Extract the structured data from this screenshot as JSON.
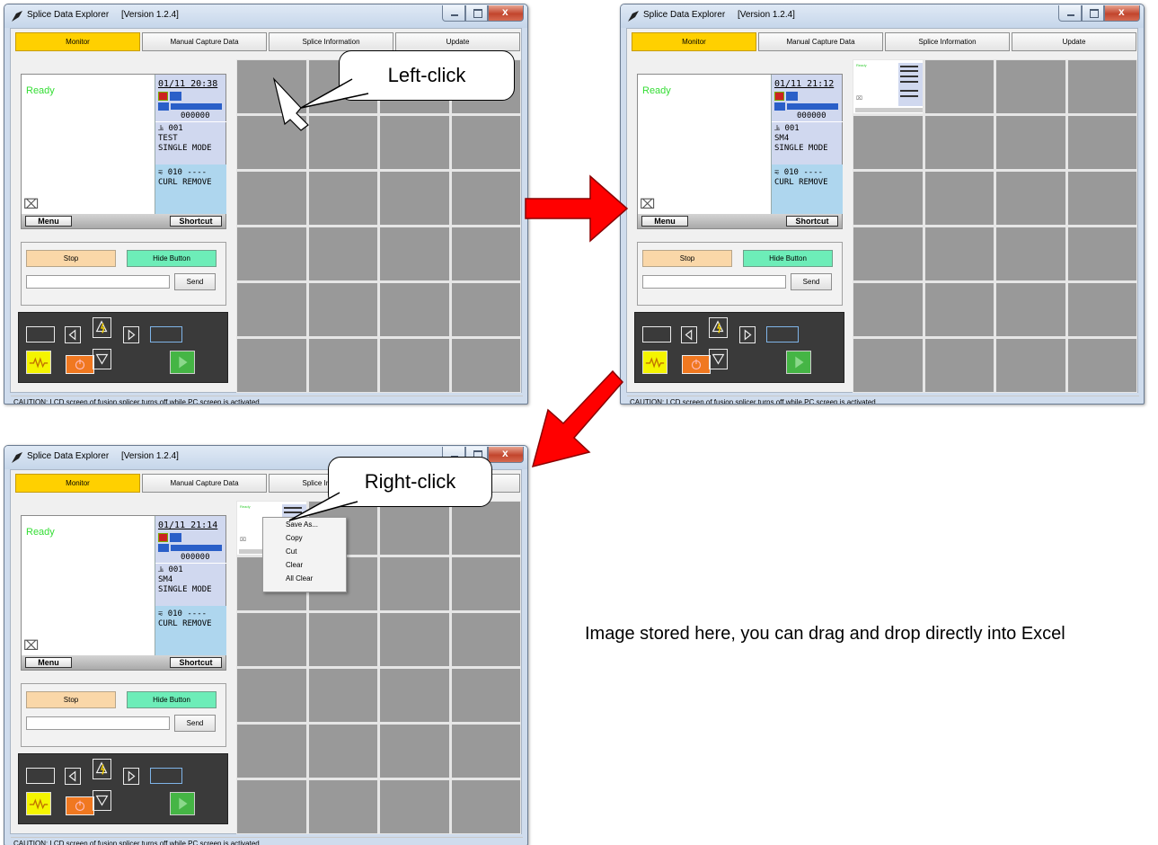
{
  "window": {
    "title": "Splice Data Explorer",
    "version": "[Version 1.2.4]",
    "tabs": [
      {
        "label": "Monitor",
        "active": true
      },
      {
        "label": "Manual Capture Data",
        "active": false
      },
      {
        "label": "Splice Information",
        "active": false
      },
      {
        "label": "Update",
        "active": false
      }
    ],
    "lcd": {
      "status": "Ready",
      "counter": "000000",
      "program_no": "001",
      "heat_no": "010 ----",
      "heat_name": "CURL REMOVE",
      "menu_label": "Menu",
      "shortcut_label": "Shortcut"
    },
    "controls": {
      "stop_label": "Stop",
      "hide_label": "Hide Button",
      "send_label": "Send",
      "input_value": ""
    },
    "status_bar": "CAUTION: LCD screen of fusion splicer turns off while PC screen is activated."
  },
  "screens": [
    {
      "datetime": "01/11 20:38",
      "fiber": "TEST",
      "mode": "SINGLE MODE"
    },
    {
      "datetime": "01/11 21:12",
      "fiber": "SM4",
      "mode": "SINGLE MODE"
    },
    {
      "datetime": "01/11 21:14",
      "fiber": "SM4",
      "mode": "SINGLE MODE"
    }
  ],
  "thumbnail": {
    "status": "Ready"
  },
  "callouts": {
    "left_click": "Left-click",
    "right_click": "Right-click"
  },
  "context_menu": [
    "Save As...",
    "Copy",
    "Cut",
    "Clear",
    "All Clear"
  ],
  "annotation": "Image stored here, you can drag and drop directly into Excel",
  "colors": {
    "tab_active": "#ffd000",
    "stop_button": "#fad7a8",
    "hide_button": "#6dedb8",
    "grid_cell": "#999999",
    "arrow": "#ff0000",
    "ready_text": "#33dd33"
  }
}
